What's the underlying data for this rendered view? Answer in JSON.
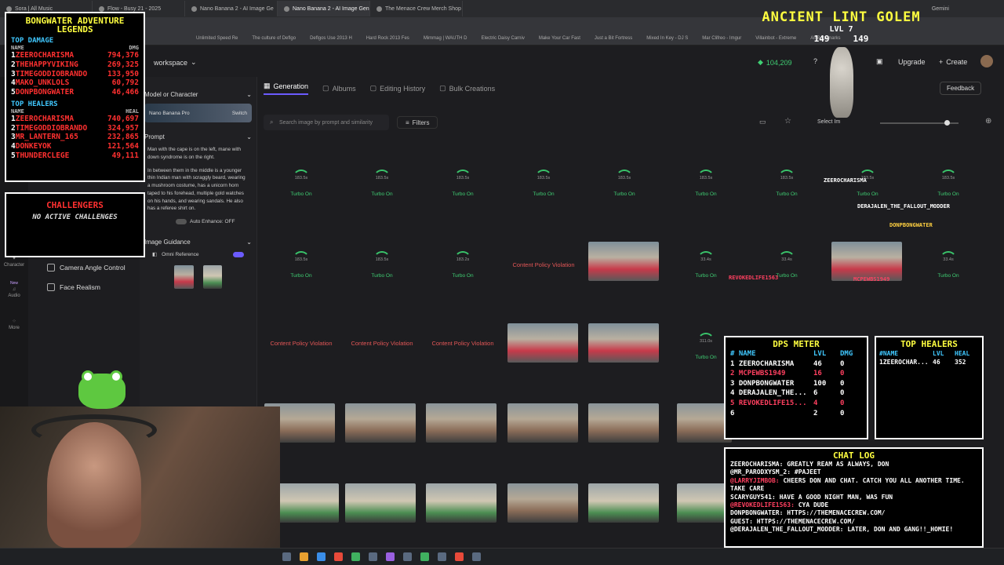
{
  "browser": {
    "tabs": [
      "Sora | All Music",
      "Flow - Busy 21 - 2025",
      "Nano Banana 2 - AI Image Ge",
      "Nano Banana 2 - AI Image Gen",
      "The Menace Crew Merch Shop"
    ],
    "gemini_label": "Gemini",
    "bookmarks": [
      "Unlimited Speed Re",
      "The culture of Deflgo",
      "Deflgos Use 2013 H",
      "Hard Rock 2013 Fes",
      "Mimmag | WAUTH D",
      "Electric Daisy Carniv",
      "Make Your Car Fast",
      "Just a Bit Fortress",
      "Mixed In Key - DJ S",
      "Mar Clifreo - Imgur",
      "Villainbot - Extreme",
      "All Bookmarks"
    ]
  },
  "app": {
    "workspace_label": "workspace",
    "credits": "104,209",
    "upgrade": "Upgrade",
    "create": "Create",
    "feedback": "Feedback",
    "rail": [
      {
        "label": "Character"
      },
      {
        "label": "Audio"
      },
      {
        "label": "More"
      }
    ],
    "new_badge": "New",
    "tools": [
      "Camera Angle Control",
      "Face Realism"
    ],
    "panel": {
      "model_header": "Model or Character",
      "model_name": "Nano Banana Pro",
      "switch_label": "Switch",
      "prompt_header": "Prompt",
      "prompt_text": "Man with the cape is on the left, mane with down syndrome is on the right.",
      "prompt_text2": "In between them in the middle is a younger thin Indian man with scraggly beard, wearing a mushroom costume, has a unicorn horn taped to his forehead, multiple gold watches on his hands, and wearing sandals. He also has a referee shirt on.",
      "auto_enhance": "Auto Enhance: OFF",
      "guidance_header": "Image Guidance",
      "omni_reference": "Omni Reference"
    },
    "main_tabs": [
      "Generation",
      "Albums",
      "Editing History",
      "Bulk Creations"
    ],
    "search_placeholder": "Search image by prompt and similarity",
    "filters": "Filters",
    "select_label": "Select Im",
    "turbo": "Turbo On",
    "violation": "Content Policy Violation",
    "row1_times": [
      "183.5s",
      "183.5s",
      "183.5s",
      "183.5s",
      "183.5s",
      "183.5s",
      "183.5s",
      "183.5s",
      "183.5s"
    ],
    "row2_times": [
      "183.5s",
      "183.5s",
      "183.2s",
      "33.4s",
      "33.4s",
      "33.4s"
    ],
    "row3_time": "311.0s"
  },
  "leaderboard": {
    "title": "BONGWATER ADVENTURE LEGENDS",
    "damage_header": "TOP DAMAGE",
    "name_col": "NAME",
    "dmg_col": "DMG",
    "heal_col": "HEAL",
    "damage": [
      {
        "rank": "1",
        "name": "ZEEROCHARISMA",
        "value": "794,376"
      },
      {
        "rank": "2",
        "name": "THEHAPPYVIKING",
        "value": "269,325"
      },
      {
        "rank": "3",
        "name": "TIMEGODDIOBRANDO",
        "value": "133,950"
      },
      {
        "rank": "4",
        "name": "MAKO_UNKLOLS",
        "value": "60,792"
      },
      {
        "rank": "5",
        "name": "DONPBONGWATER",
        "value": "46,466"
      }
    ],
    "healers_header": "TOP HEALERS",
    "healers": [
      {
        "rank": "1",
        "name": "ZEEROCHARISMA",
        "value": "740,697"
      },
      {
        "rank": "2",
        "name": "TIMEGODDIOBRANDO",
        "value": "324,957"
      },
      {
        "rank": "3",
        "name": "MR_LANTERN_165",
        "value": "232,865"
      },
      {
        "rank": "4",
        "name": "DONKEYOK",
        "value": "121,564"
      },
      {
        "rank": "5",
        "name": "THUNDERCLEGE",
        "value": "49,111"
      }
    ]
  },
  "challengers": {
    "title": "CHALLENGERS",
    "status": "NO ACTIVE CHALLENGES"
  },
  "boss": {
    "name": "ANCIENT LINT GOLEM",
    "level": "LVL 7",
    "hp_current": "149",
    "hp_max": "149"
  },
  "sprites": [
    "ZEEROCHARISMA",
    "DERAJALEN_THE_FALLOUT_MODDER",
    "DONPBONGWATER",
    "REVOKEDLIFE1563",
    "MCPEWBS1949"
  ],
  "dps": {
    "title": "DPS METER",
    "name_col": "NAME",
    "lvl_col": "LVL",
    "dmg_col": "DMG",
    "rows": [
      {
        "rank": "1",
        "name": "ZEEROCHARISMA",
        "lvl": "46",
        "dmg": "0",
        "color": "#ffffff"
      },
      {
        "rank": "2",
        "name": "MCPEWBS1949",
        "lvl": "16",
        "dmg": "0",
        "color": "#ff4060"
      },
      {
        "rank": "3",
        "name": "DONPBONGWATER",
        "lvl": "100",
        "dmg": "0",
        "color": "#ffffff"
      },
      {
        "rank": "4",
        "name": "DERAJALEN_THE...",
        "lvl": "6",
        "dmg": "0",
        "color": "#ffffff"
      },
      {
        "rank": "5",
        "name": "REVOKEDLIFE15...",
        "lvl": "4",
        "dmg": "0",
        "color": "#ff4060"
      },
      {
        "rank": "6",
        "name": "",
        "lvl": "2",
        "dmg": "0",
        "color": "#ffffff"
      }
    ]
  },
  "heal": {
    "title": "TOP HEALERS",
    "name_col": "NAME",
    "lvl_col": "LVL",
    "heal_col": "HEAL",
    "row": {
      "rank": "1",
      "name": "ZEEROCHAR...",
      "lvl": "46",
      "heal": "352"
    }
  },
  "chat": {
    "title": "CHAT LOG",
    "lines": [
      {
        "user": "ZEEROCHARISMA:",
        "text": "GREATLY REAM AS ALWAYS, DON",
        "color": "#ffffff"
      },
      {
        "user": "@MR_PARODXYSM_2:",
        "text": "#PAJEET",
        "color": "#ffffff"
      },
      {
        "user": "@LARRYJIMBOB:",
        "text": "CHEERS DON AND CHAT. CATCH YOU ALL ANOTHER TIME. TAKE CARE",
        "color": "#ff4060"
      },
      {
        "user": "SCARYGUY541:",
        "text": "HAVE A GOOD NIGHT MAN, WAS FUN",
        "color": "#ffffff"
      },
      {
        "user": "@REVOKEDLIFE1563:",
        "text": "CYA DUDE",
        "color": "#ff4060"
      },
      {
        "user": "DONPBONGWATER:",
        "text": "HTTPS://THEMENACECREW.COM/",
        "color": "#ffffff"
      },
      {
        "user": "GUEST:",
        "text": "HTTPS://THEMENACECREW.COM/",
        "color": "#ffffff"
      },
      {
        "user": "@DERAJALEN_THE_FALLOUT_MODDER:",
        "text": "LATER, DON AND GANG!!_HOMIE!",
        "color": "#ffffff"
      }
    ]
  },
  "colors": {
    "accent": "#6b5bff",
    "turbo": "#3fcf73",
    "violation": "#e35656",
    "overlay_title": "#ffff40"
  }
}
